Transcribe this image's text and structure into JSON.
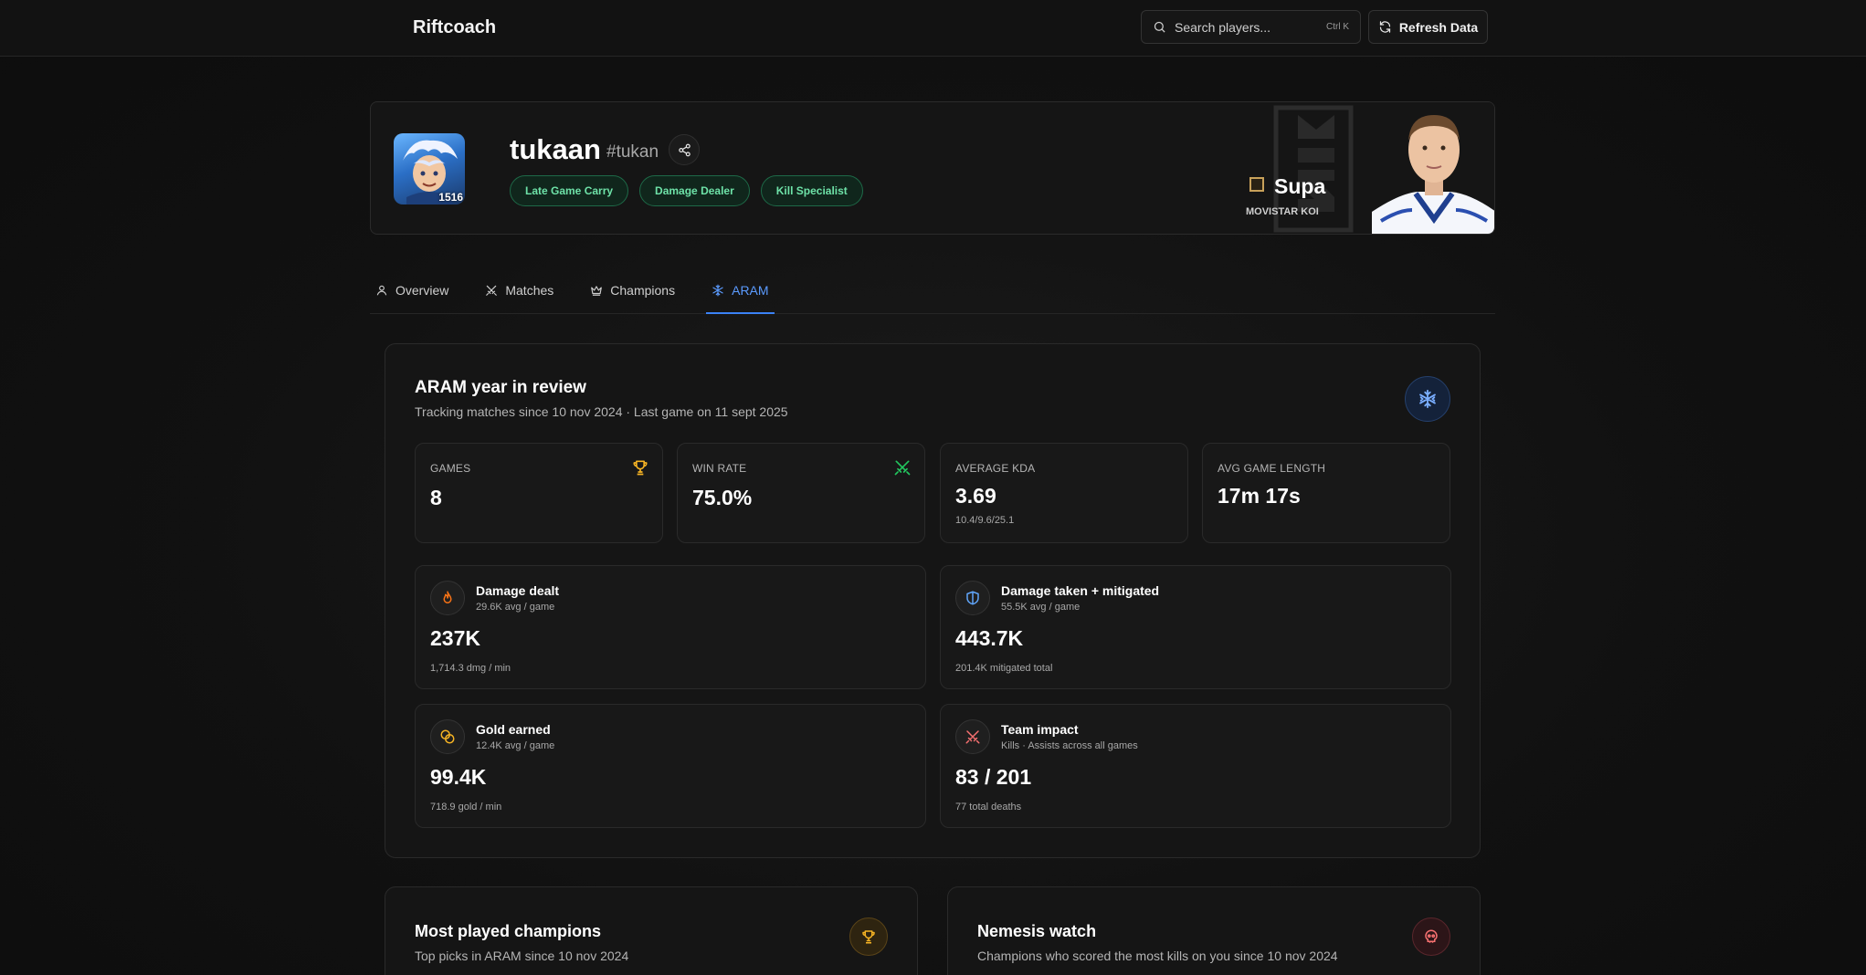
{
  "app": {
    "title": "Riftcoach"
  },
  "search": {
    "placeholder": "Search players...",
    "shortcut": "Ctrl K"
  },
  "header": {
    "refresh_label": "Refresh Data"
  },
  "profile": {
    "name": "tukaan",
    "tag": "#tukan",
    "level": "1516",
    "badges": [
      "Late Game Carry",
      "Damage Dealer",
      "Kill Specialist"
    ],
    "pro": {
      "name": "Supa",
      "team": "MOVISTAR KOI"
    }
  },
  "tabs": [
    {
      "label": "Overview",
      "icon": "user-icon"
    },
    {
      "label": "Matches",
      "icon": "swords-icon"
    },
    {
      "label": "Champions",
      "icon": "crown-icon"
    },
    {
      "label": "ARAM",
      "icon": "snowflake-icon",
      "active": true
    }
  ],
  "aram": {
    "title": "ARAM year in review",
    "subtitle": "Tracking matches since 10 nov 2024 · Last game on 11 sept 2025",
    "stats": [
      {
        "label": "GAMES",
        "value": "8",
        "sub": "",
        "icon": "trophy-icon"
      },
      {
        "label": "WIN RATE",
        "value": "75.0%",
        "sub": "",
        "icon": "swords-icon"
      },
      {
        "label": "AVERAGE KDA",
        "value": "3.69",
        "sub": "10.4/9.6/25.1",
        "icon": ""
      },
      {
        "label": "AVG GAME LENGTH",
        "value": "17m 17s",
        "sub": "",
        "icon": ""
      }
    ],
    "cards": [
      {
        "title": "Damage dealt",
        "subtitle": "29.6K avg / game",
        "value": "237K",
        "footer": "1,714.3 dmg / min",
        "icon": "flame-icon"
      },
      {
        "title": "Damage taken + mitigated",
        "subtitle": "55.5K avg / game",
        "value": "443.7K",
        "footer": "201.4K mitigated total",
        "icon": "shield-icon"
      },
      {
        "title": "Gold earned",
        "subtitle": "12.4K avg / game",
        "value": "99.4K",
        "footer": "718.9 gold / min",
        "icon": "coins-icon"
      },
      {
        "title": "Team impact",
        "subtitle": "Kills · Assists across all games",
        "value": "83 / 201",
        "footer": "77 total deaths",
        "icon": "swords-icon"
      }
    ]
  },
  "bottom": [
    {
      "title": "Most played champions",
      "subtitle": "Top picks in ARAM since 10 nov 2024",
      "icon": "trophy-icon"
    },
    {
      "title": "Nemesis watch",
      "subtitle": "Champions who scored the most kills on you since 10 nov 2024",
      "icon": "skull-icon"
    }
  ],
  "colors": {
    "accent": "#3b82f6",
    "badge_green": "#6ee2a8",
    "trophy_gold": "#f5b324",
    "winrate_green": "#22c55e",
    "damage_orange": "#f97316",
    "shield_blue": "#60a5fa",
    "impact_red": "#f87171"
  }
}
